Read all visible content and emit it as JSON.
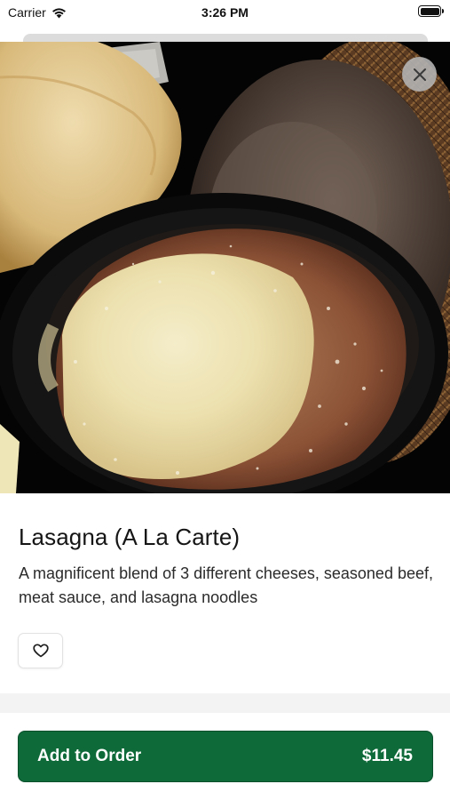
{
  "status_bar": {
    "carrier": "Carrier",
    "time": "3:26 PM",
    "wifi_icon": "wifi-icon",
    "battery_icon": "battery-icon"
  },
  "hero": {
    "image": "lasagna-photo",
    "close_icon": "close-icon"
  },
  "item": {
    "title": "Lasagna (A La Carte)",
    "description": "A magnificent blend of 3 different cheeses, seasoned beef, meat sauce, and lasagna noodles",
    "favorite_icon": "heart-outline-icon"
  },
  "footer": {
    "add_label": "Add to Order",
    "price": "$11.45"
  },
  "colors": {
    "primary": "#0f6a3a",
    "background": "#ffffff",
    "text": "#1c1c1c"
  }
}
